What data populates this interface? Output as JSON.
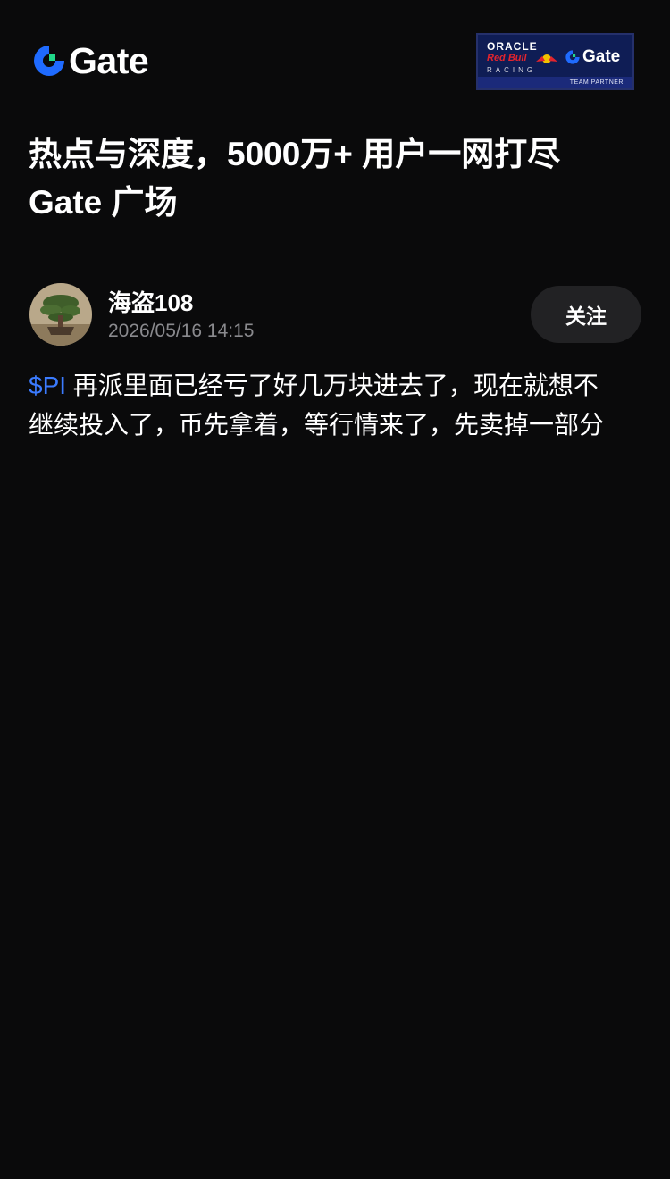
{
  "header": {
    "brand": "Gate",
    "partner_badge": {
      "oracle": "ORACLE",
      "redbull": "Red Bull",
      "racing": "RACING",
      "brand": "Gate",
      "tag": "TEAM PARTNER"
    }
  },
  "headline": {
    "line1": "热点与深度，5000万+ 用户一网打尽",
    "line2": "Gate 广场"
  },
  "post": {
    "author": "海盗108",
    "timestamp": "2026/05/16 14:15",
    "follow_label": "关注",
    "ticker": "$PI",
    "text_line1": " 再派里面已经亏了好几万块进去了，现在就想不",
    "text_line2": "继续投入了，币先拿着，等行情来了，先卖掉一部分"
  },
  "colors": {
    "background": "#0a0a0b",
    "ticker": "#3b7bff",
    "brand_blue": "#1f6bff",
    "brand_green": "#20d98a"
  }
}
